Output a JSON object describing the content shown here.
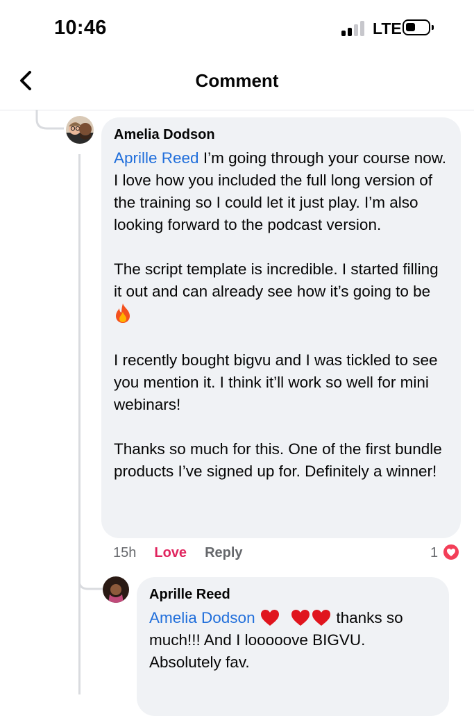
{
  "status_bar": {
    "time": "10:46",
    "network": "LTE"
  },
  "header": {
    "title": "Comment"
  },
  "comment": {
    "author": "Amelia Dodson",
    "mention": "Aprille Reed",
    "p1_rest": " I’m going through your course now. I love how you included the full long version of the training so I could let it just play. I’m also looking forward to the podcast version.",
    "p2": "The script template is incredible. I started filling it out and can already see how it’s going to be ",
    "p2_emoji": "fire-icon",
    "p3": "I recently bought bigvu and I was tickled to see you mention it. I think it’ll work so well for mini webinars!",
    "p4": "Thanks so much for this. One of the first bundle products I’ve signed up for. Definitely a winner!",
    "time": "15h",
    "love_label": "Love",
    "reply_label": "Reply",
    "reaction_count": "1",
    "reaction_type": "love-reaction-icon"
  },
  "reply": {
    "author": "Aprille Reed",
    "mention": "Amelia Dodson",
    "emojis": [
      "red-heart-icon",
      "red-heart-icon",
      "red-heart-icon"
    ],
    "text_after_emojis": " thanks so much!!! And I looooove BIGVU. Absolutely fav."
  },
  "colors": {
    "mention": "#216fdb",
    "love": "#e0245e",
    "bubble_bg": "#f0f2f5",
    "meta_text": "#65676b"
  }
}
